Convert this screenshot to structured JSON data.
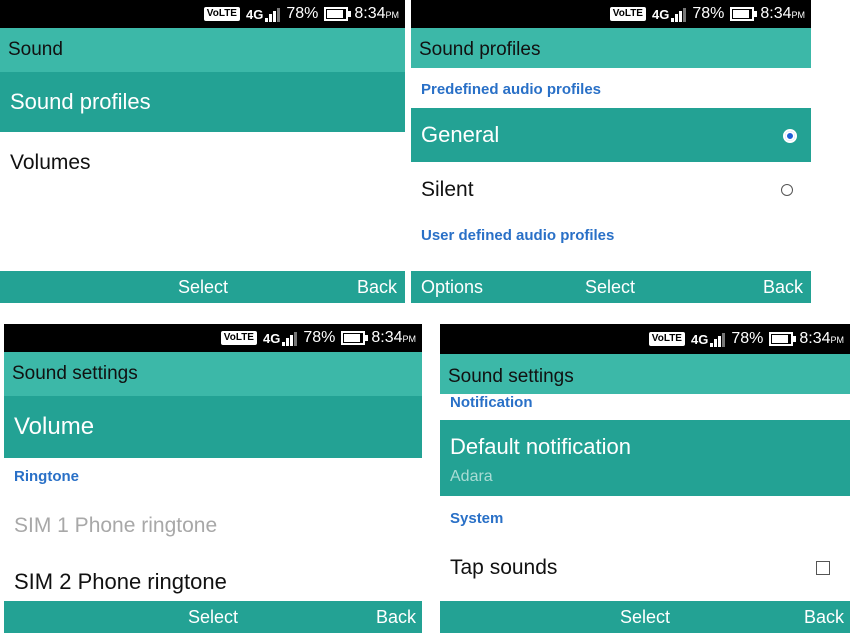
{
  "status": {
    "volte": "VoLTE",
    "network": "4G",
    "battery": "78%",
    "time": "8:34",
    "ampm": "PM"
  },
  "screen1": {
    "title": "Sound",
    "items": [
      "Sound profiles",
      "Volumes"
    ],
    "softkeys": {
      "center": "Select",
      "right": "Back"
    }
  },
  "screen2": {
    "title": "Sound profiles",
    "section1": "Predefined audio profiles",
    "profiles": [
      {
        "label": "General",
        "selected": true
      },
      {
        "label": "Silent",
        "selected": false
      }
    ],
    "section2": "User defined audio profiles",
    "softkeys": {
      "left": "Options",
      "center": "Select",
      "right": "Back"
    }
  },
  "screen3": {
    "title": "Sound settings",
    "volume": "Volume",
    "ringtone_section": "Ringtone",
    "sim1": "SIM 1 Phone ringtone",
    "sim2": "SIM 2 Phone ringtone",
    "softkeys": {
      "center": "Select",
      "right": "Back"
    }
  },
  "screen4": {
    "title": "Sound settings",
    "notification_section": "Notification",
    "default_notification": "Default notification",
    "default_notification_value": "Adara",
    "system_section": "System",
    "tap_sounds": "Tap sounds",
    "tap_sounds_checked": false,
    "softkeys": {
      "center": "Select",
      "right": "Back"
    }
  },
  "colors": {
    "titlebar": "#3cb8a8",
    "selected": "#23a294",
    "section": "#2970c7",
    "disabled": "#a8a8a8"
  }
}
